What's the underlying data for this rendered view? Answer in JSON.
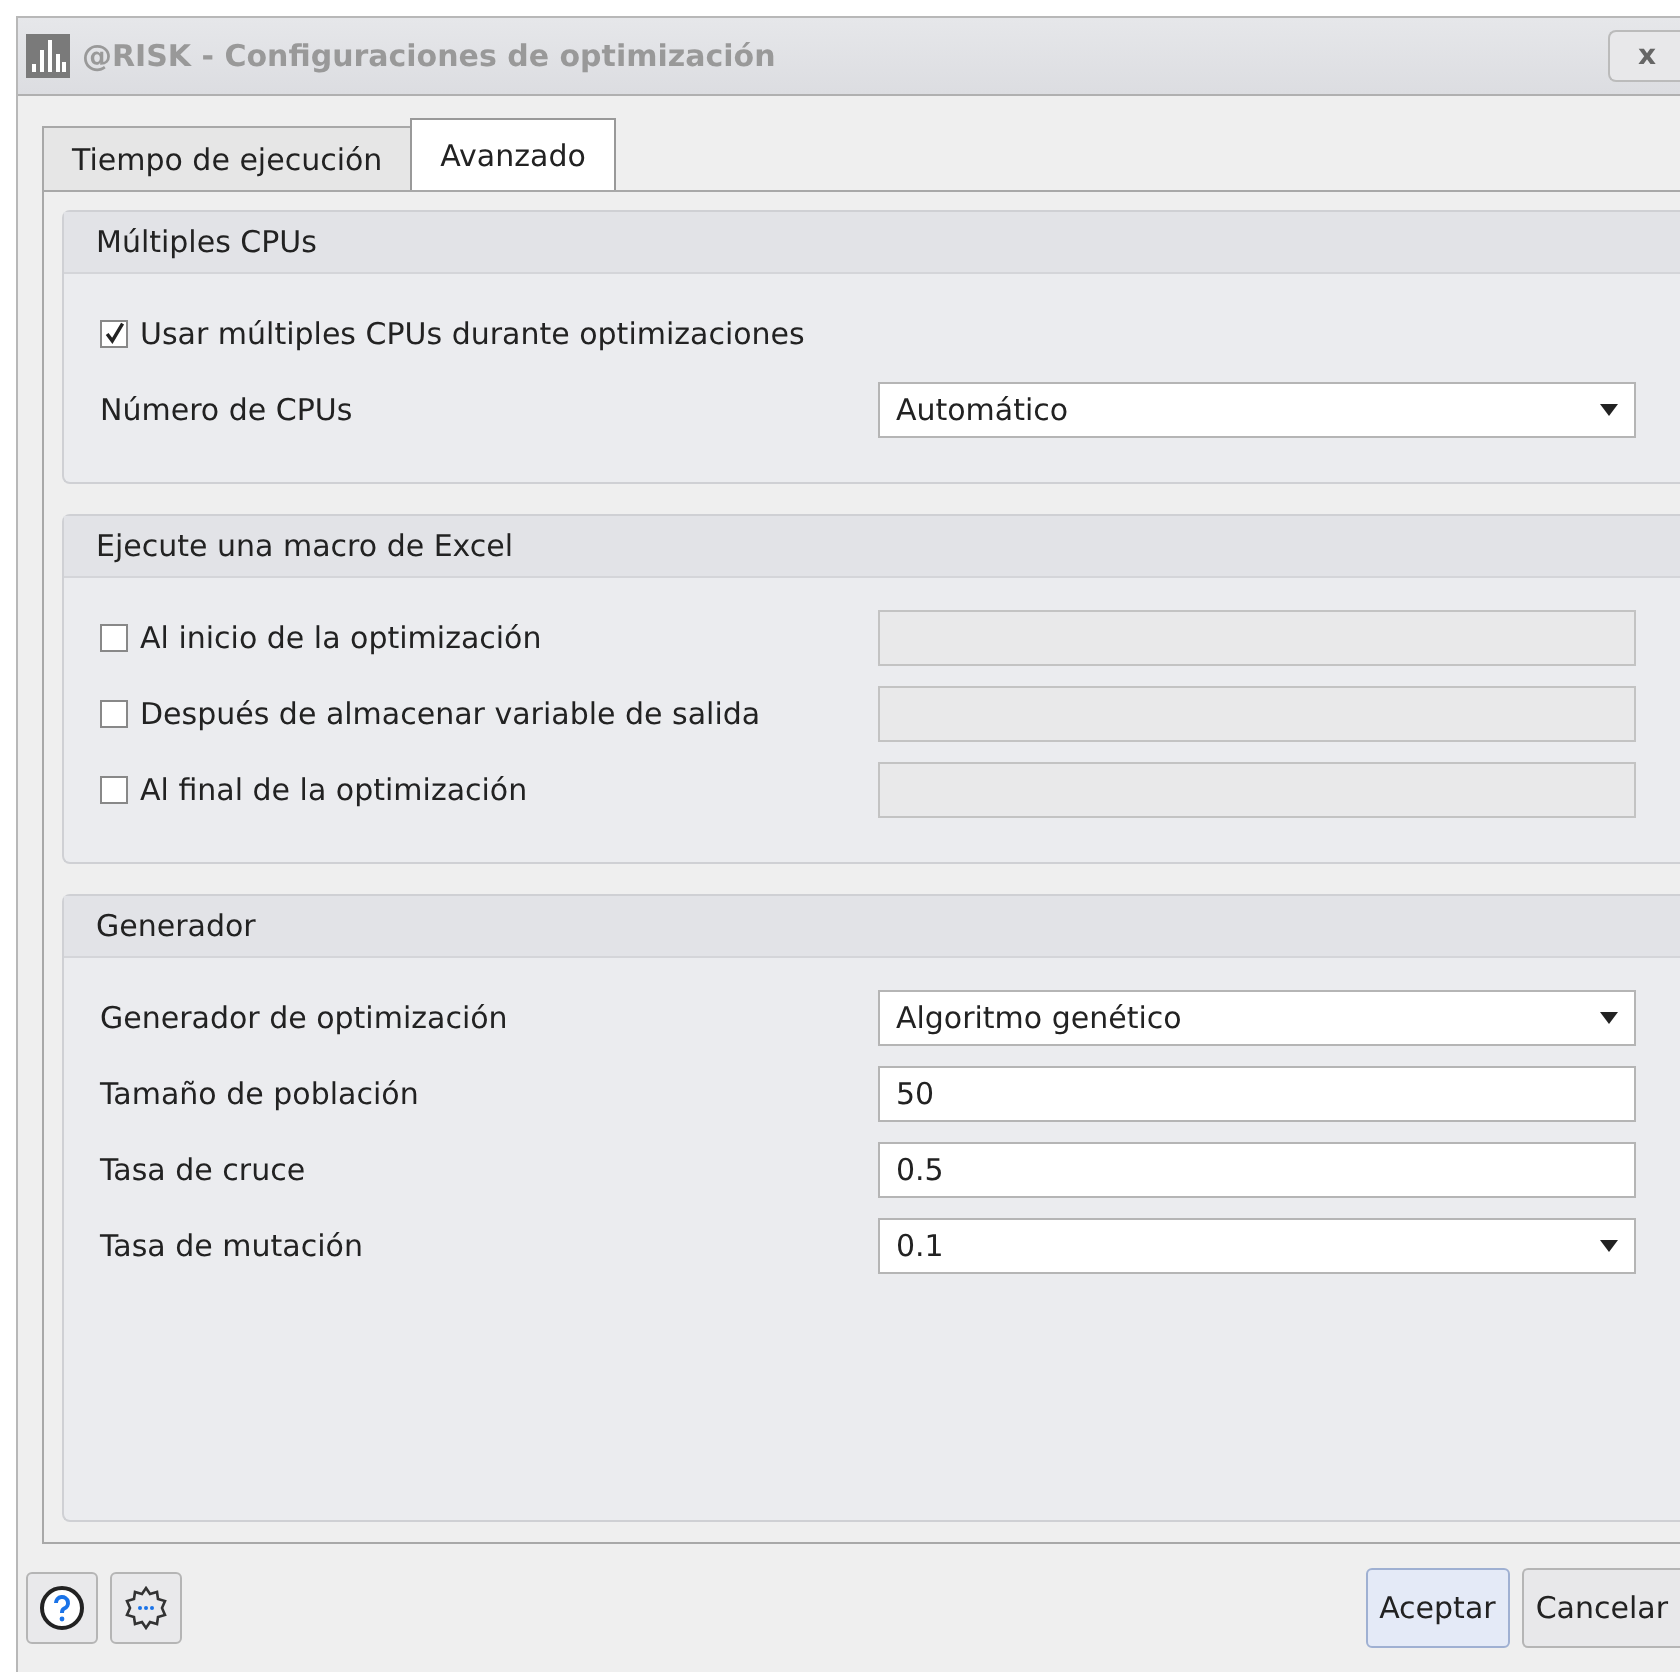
{
  "window": {
    "title": "@RISK - Configuraciones de optimización",
    "close_label": "x"
  },
  "tabs": [
    {
      "label": "Tiempo de ejecución",
      "selected": false
    },
    {
      "label": "Avanzado",
      "selected": true
    }
  ],
  "groups": [
    {
      "title": "Múltiples CPUs",
      "rows": [
        {
          "kind": "checkbox",
          "label": "Usar múltiples CPUs durante optimizaciones",
          "checked": true
        },
        {
          "kind": "dropdown",
          "label": "Número de CPUs",
          "value": "Automático"
        }
      ]
    },
    {
      "title": "Ejecute una macro de Excel",
      "rows": [
        {
          "kind": "checkfield",
          "label": "Al inicio de la optimización",
          "checked": false,
          "field_disabled": true
        },
        {
          "kind": "checkfield",
          "label": "Después de almacenar variable de salida",
          "checked": false,
          "field_disabled": true
        },
        {
          "kind": "checkfield",
          "label": "Al final de la optimización",
          "checked": false,
          "field_disabled": true
        }
      ]
    },
    {
      "title": "Generador",
      "rows": [
        {
          "kind": "dropdown",
          "label": "Generador de optimización",
          "value": "Algoritmo genético"
        },
        {
          "kind": "input",
          "label": "Tamaño de población",
          "value": "50"
        },
        {
          "kind": "input",
          "label": "Tasa de cruce",
          "value": "0.5"
        },
        {
          "kind": "dropdown",
          "label": "Tasa de mutación",
          "value": "0.1"
        }
      ]
    }
  ],
  "buttons": [
    {
      "label": "Aceptar",
      "default": true
    },
    {
      "label": "Cancelar",
      "default": false
    }
  ]
}
